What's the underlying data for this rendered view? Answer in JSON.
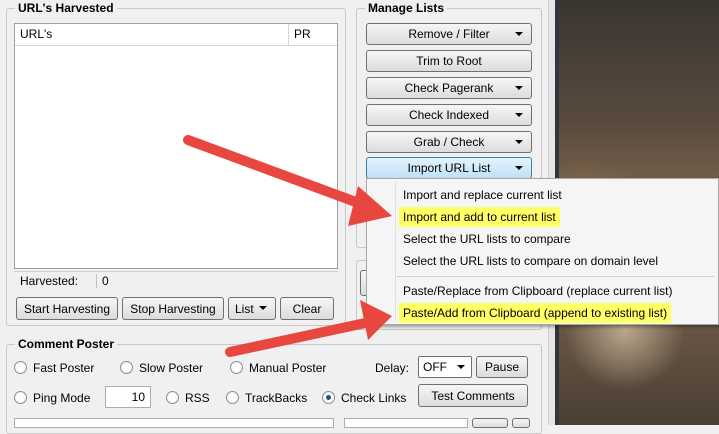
{
  "harvested_panel": {
    "title": "URL's Harvested",
    "columns": [
      "URL's",
      "PR"
    ],
    "status_label": "Harvested:",
    "status_value": "0",
    "start_button": "Start Harvesting",
    "stop_button": "Stop Harvesting",
    "list_button": "List",
    "clear_button": "Clear"
  },
  "manage_lists": {
    "title": "Manage Lists",
    "buttons": [
      {
        "label": "Remove / Filter",
        "dropdown": true
      },
      {
        "label": "Trim to Root",
        "dropdown": false
      },
      {
        "label": "Check Pagerank",
        "dropdown": true
      },
      {
        "label": "Check Indexed",
        "dropdown": true
      },
      {
        "label": "Grab / Check",
        "dropdown": true
      },
      {
        "label": "Import URL List",
        "dropdown": true
      }
    ]
  },
  "import_menu": {
    "items": [
      {
        "label": "Import and replace current list",
        "highlighted": false
      },
      {
        "label": "Import and add to current list",
        "highlighted": true
      },
      {
        "label": "Select the URL lists to compare",
        "highlighted": false
      },
      {
        "label": "Select the URL lists to compare on domain level",
        "highlighted": false
      },
      {
        "label": "Paste/Replace from Clipboard (replace current list)",
        "highlighted": false
      },
      {
        "label": "Paste/Add from Clipboard (append to existing list)",
        "highlighted": true
      }
    ],
    "highlight_color": "#ffff66"
  },
  "comment_poster": {
    "title": "Comment Poster",
    "radios": [
      {
        "label": "Fast Poster",
        "checked": false
      },
      {
        "label": "Slow Poster",
        "checked": false
      },
      {
        "label": "Manual Poster",
        "checked": false
      },
      {
        "label": "Ping Mode",
        "checked": false
      },
      {
        "label": "RSS",
        "checked": false
      },
      {
        "label": "TrackBacks",
        "checked": false
      },
      {
        "label": "Check Links",
        "checked": true
      }
    ],
    "delay_label": "Delay:",
    "delay_value": "OFF",
    "pause_button": "Pause",
    "threads_value": "10",
    "test_button": "Test Comments"
  },
  "colors": {
    "arrow": "#e8473f",
    "window_bg": "#f0f0f0",
    "active_button": "#bfe1f6"
  }
}
